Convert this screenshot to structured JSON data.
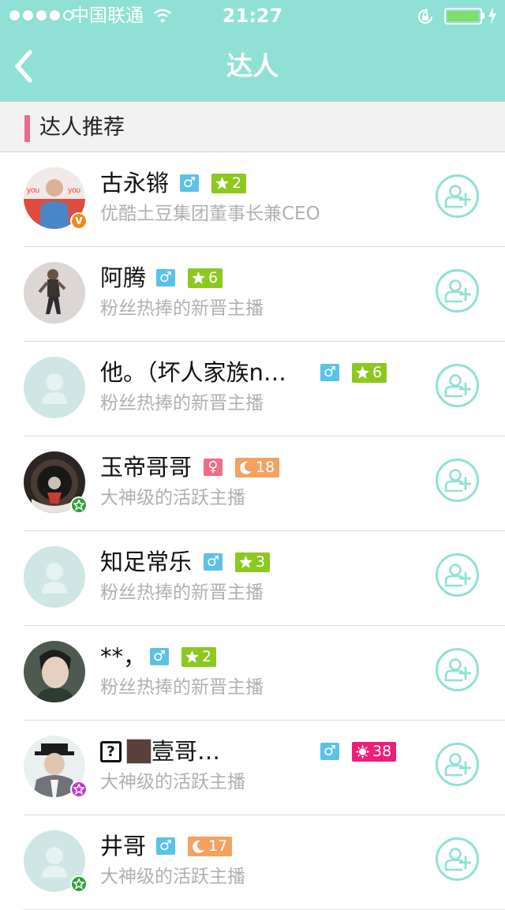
{
  "status_bar": {
    "carrier": "中国联通",
    "time": "21:27",
    "signal_bars": 4,
    "signal_total": 5,
    "battery_level": 1.0
  },
  "nav": {
    "title": "达人",
    "back_icon": "chevron-left-icon"
  },
  "section": {
    "title": "达人推荐"
  },
  "colors": {
    "header": "#8fe1d5",
    "male": "#5bc1e7",
    "female": "#ef6b86",
    "level_green": "#8cc820",
    "level_orange": "#f5a160",
    "level_pink": "#ee1e78"
  },
  "users": [
    {
      "name": "古永锵",
      "gender": "male",
      "gender_symbol": "♂",
      "level": "2",
      "level_icon": "star-icon",
      "level_color": "#8cc820",
      "subtitle": "优酷土豆集团董事长兼CEO",
      "badge": "V",
      "badge_color": "#f08a1c",
      "avatar": "photo-man-red-shirt"
    },
    {
      "name": "阿腾",
      "gender": "male",
      "gender_symbol": "♂",
      "level": "6",
      "level_icon": "star-icon",
      "level_color": "#8cc820",
      "subtitle": "粉丝热捧的新晋主播",
      "badge": "",
      "avatar": "photo-dancer"
    },
    {
      "name": "他。（坏人家族n…",
      "gender": "male",
      "gender_symbol": "♂",
      "level": "6",
      "level_icon": "star-icon",
      "level_color": "#8cc820",
      "subtitle": "粉丝热捧的新晋主播",
      "badge": "",
      "avatar": "default-avatar"
    },
    {
      "name": "玉帝哥哥",
      "gender": "female",
      "gender_symbol": "♀",
      "level": "18",
      "level_icon": "moon-icon",
      "level_color": "#f5a160",
      "subtitle": "大神级的活跃主播",
      "badge": "star",
      "badge_color": "#2aa13a",
      "avatar": "photo-car-wheel"
    },
    {
      "name": "知足常乐",
      "gender": "male",
      "gender_symbol": "♂",
      "level": "3",
      "level_icon": "star-icon",
      "level_color": "#8cc820",
      "subtitle": "粉丝热捧的新晋主播",
      "badge": "",
      "avatar": "default-avatar"
    },
    {
      "name": "**，",
      "gender": "male",
      "gender_symbol": "♂",
      "level": "2",
      "level_icon": "star-icon",
      "level_color": "#8cc820",
      "subtitle": "粉丝热捧的新晋主播",
      "badge": "",
      "avatar": "photo-young-man"
    },
    {
      "name": "壹哥…",
      "gender": "male",
      "gender_symbol": "♂",
      "level": "38",
      "level_icon": "sun-icon",
      "level_color": "#ee1e78",
      "subtitle": "大神级的活跃主播",
      "badge": "star",
      "badge_color": "#c23bd0",
      "avatar": "photo-man-hat",
      "name_prefix_glyph": "?"
    },
    {
      "name": "井哥",
      "gender": "male",
      "gender_symbol": "♂",
      "level": "17",
      "level_icon": "moon-icon",
      "level_color": "#f5a160",
      "subtitle": "大神级的活跃主播",
      "badge": "star",
      "badge_color": "#2aa13a",
      "avatar": "default-avatar"
    }
  ]
}
